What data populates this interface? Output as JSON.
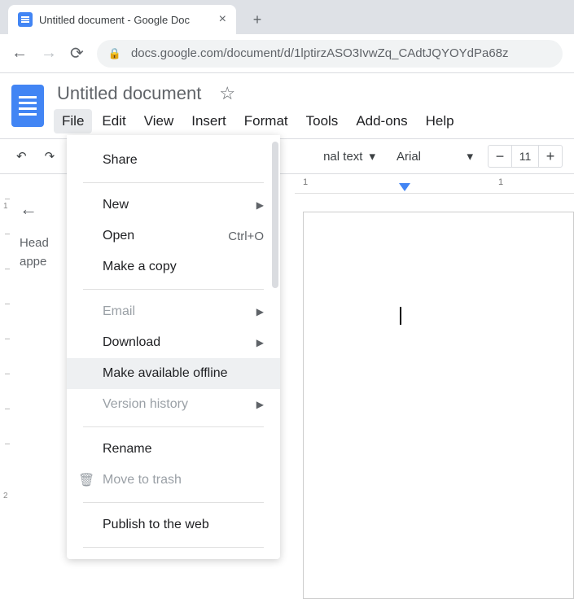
{
  "browser": {
    "tab_title": "Untitled document - Google Doc",
    "url": "docs.google.com/document/d/1lptirzASO3IvwZq_CAdtJQYOYdPa68z"
  },
  "doc": {
    "title": "Untitled document"
  },
  "menubar": [
    "File",
    "Edit",
    "View",
    "Insert",
    "Format",
    "Tools",
    "Add-ons",
    "Help"
  ],
  "toolbar": {
    "style_label": "nal text",
    "font_label": "Arial",
    "font_size": "11"
  },
  "outline": {
    "placeholder_l1": "Head",
    "placeholder_l2": "appe"
  },
  "ruler": {
    "m1": "1",
    "m2": "1"
  },
  "ticks": {
    "n1": "1",
    "n2": "2"
  },
  "file_menu": {
    "share": "Share",
    "new": "New",
    "open": "Open",
    "open_shortcut": "Ctrl+O",
    "make_copy": "Make a copy",
    "email": "Email",
    "download": "Download",
    "offline": "Make available offline",
    "version_history": "Version history",
    "rename": "Rename",
    "move_trash": "Move to trash",
    "publish": "Publish to the web"
  }
}
